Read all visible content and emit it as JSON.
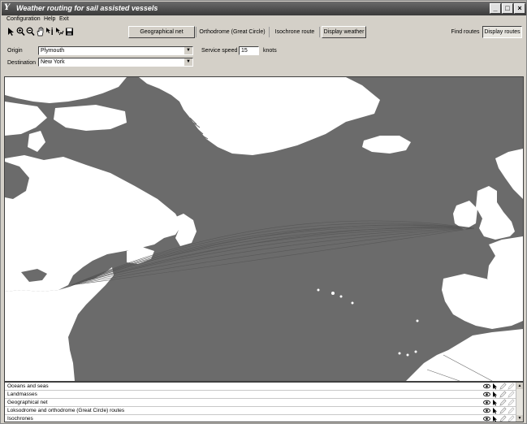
{
  "window": {
    "title": "Weather routing for sail assisted vessels",
    "app_icon": "yt-app-icon",
    "controls": {
      "minimize": "_",
      "maximize": "□",
      "close": "×"
    }
  },
  "menu": {
    "items": [
      "Configuration",
      "Help",
      "Exit"
    ]
  },
  "toolbar": {
    "tools": [
      "pointer-icon",
      "zoom-in-icon",
      "zoom-out-icon",
      "pan-hand-icon",
      "info-pointer-icon",
      "route-pointer-icon",
      "save-icon"
    ],
    "geo_net_label": "Geographical net",
    "orthodrome_label": "Orthodrome (Great Circle)",
    "isochrone_label": "Isochrone route",
    "display_weather_label": "Display weather",
    "find_routes_label": "Find routes",
    "display_routes_label": "Display routes"
  },
  "form": {
    "origin_label": "Origin",
    "origin_value": "Plymouth",
    "destination_label": "Destination",
    "destination_value": "New York",
    "speed_label": "Service speed",
    "speed_value": "15",
    "speed_unit": "knots"
  },
  "map": {
    "ocean_color": "#6b6b6b",
    "land_color": "#ffffff",
    "route_color": "#555555"
  },
  "layers": [
    {
      "name": "Oceans and seas"
    },
    {
      "name": "Landmasses"
    },
    {
      "name": "Geographical net"
    },
    {
      "name": "Loksodrome and orthodrome (Great Circle) routes"
    },
    {
      "name": "Isochrones"
    }
  ]
}
